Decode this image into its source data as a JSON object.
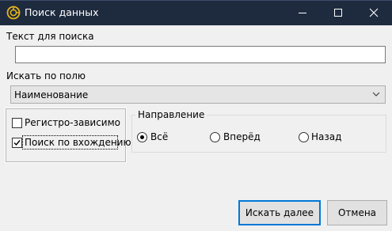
{
  "window": {
    "title": "Поиск данных",
    "icon": "app-logo-icon",
    "controls": [
      "minimize-icon",
      "maximize-icon",
      "close-icon"
    ]
  },
  "search": {
    "label": "Текст для поиска",
    "value": ""
  },
  "field": {
    "label": "Искать по полю",
    "selected": "Наименование"
  },
  "options": {
    "case_sensitive": {
      "label": "Регистро-зависимо",
      "checked": false
    },
    "partial_match": {
      "label": "Поиск по вхождению",
      "checked": true
    }
  },
  "direction": {
    "title": "Направление",
    "items": [
      {
        "label": "Всё",
        "selected": true
      },
      {
        "label": "Вперёд",
        "selected": false
      },
      {
        "label": "Назад",
        "selected": false
      }
    ]
  },
  "buttons": {
    "find_next": "Искать далее",
    "cancel": "Отмена"
  },
  "colors": {
    "titlebar": "#1e2a3e",
    "default_button_border": "#0078d7",
    "app_icon": "#e7b416"
  }
}
